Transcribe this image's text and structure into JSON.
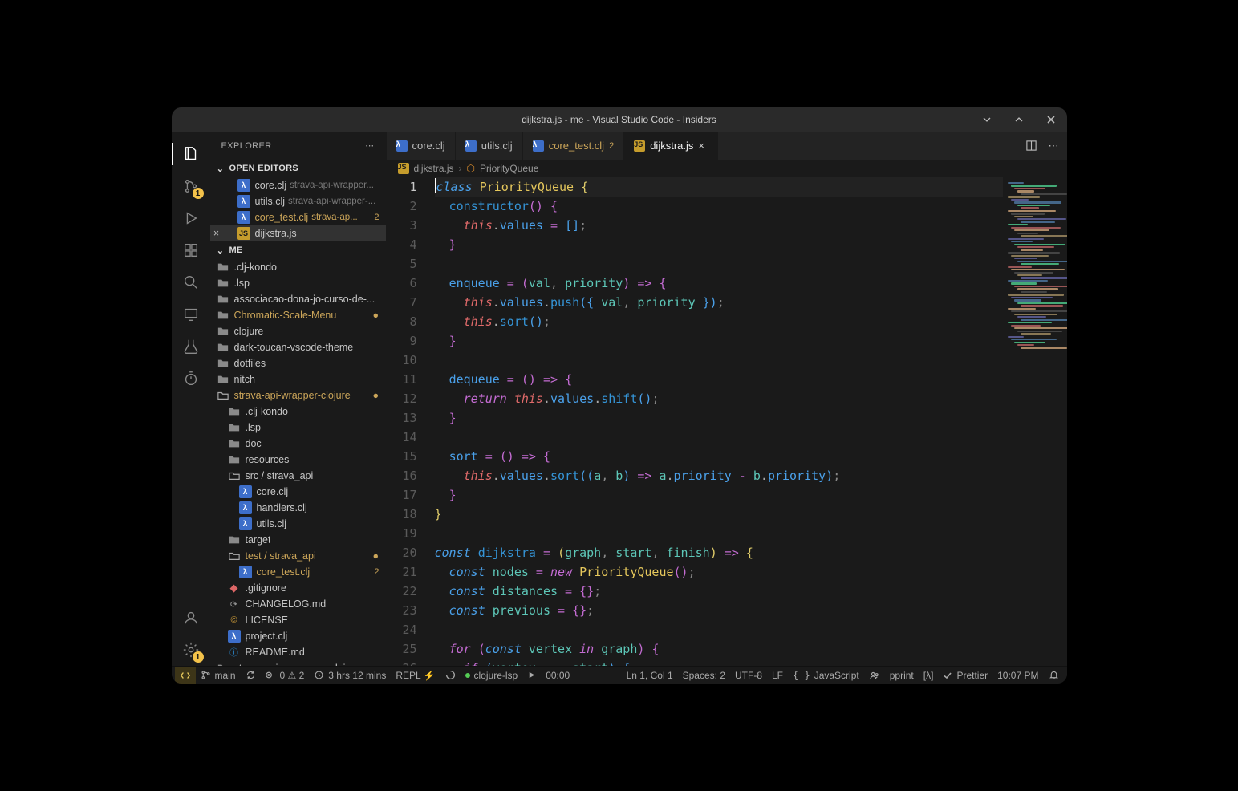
{
  "window": {
    "title": "dijkstra.js - me - Visual Studio Code - Insiders"
  },
  "activitybar": {
    "items": [
      {
        "name": "files-icon",
        "active": true
      },
      {
        "name": "source-control-icon",
        "badge": "1"
      },
      {
        "name": "run-debug-icon"
      },
      {
        "name": "extensions-icon"
      },
      {
        "name": "search-icon"
      },
      {
        "name": "remote-icon"
      },
      {
        "name": "beaker-icon"
      },
      {
        "name": "timer-icon"
      }
    ],
    "bottom": [
      {
        "name": "account-icon"
      },
      {
        "name": "settings-icon",
        "badge": "1"
      }
    ]
  },
  "sidebar": {
    "title": "EXPLORER",
    "sections": {
      "openEditors": {
        "label": "OPEN EDITORS",
        "items": [
          {
            "icon": "lambda",
            "name": "core.clj",
            "meta": "strava-api-wrapper...",
            "indent": 34
          },
          {
            "icon": "lambda",
            "name": "utils.clj",
            "meta": "strava-api-wrapper-...",
            "indent": 34
          },
          {
            "icon": "lambda",
            "name": "core_test.clj",
            "meta": "strava-ap...",
            "indent": 34,
            "modified": true,
            "badge": "2"
          },
          {
            "icon": "js",
            "name": "dijkstra.js",
            "indent": 34,
            "active": true,
            "close": true
          }
        ]
      },
      "workspace": {
        "label": "ME",
        "items": [
          {
            "icon": "folder",
            "name": ".clj-kondo",
            "indent": 8,
            "type": "folder"
          },
          {
            "icon": "folder",
            "name": ".lsp",
            "indent": 8,
            "type": "folder"
          },
          {
            "icon": "folder",
            "name": "associacao-dona-jo-curso-de-...",
            "indent": 8,
            "type": "folder"
          },
          {
            "icon": "folder",
            "name": "Chromatic-Scale-Menu",
            "indent": 8,
            "type": "folder",
            "modified": true,
            "dot": true
          },
          {
            "icon": "folder",
            "name": "clojure",
            "indent": 8,
            "type": "folder"
          },
          {
            "icon": "folder",
            "name": "dark-toucan-vscode-theme",
            "indent": 8,
            "type": "folder"
          },
          {
            "icon": "folder",
            "name": "dotfiles",
            "indent": 8,
            "type": "folder"
          },
          {
            "icon": "folder",
            "name": "nitch",
            "indent": 8,
            "type": "folder"
          },
          {
            "icon": "folder-o",
            "name": "strava-api-wrapper-clojure",
            "indent": 8,
            "type": "folder",
            "modified": true,
            "dot": true
          },
          {
            "icon": "folder",
            "name": ".clj-kondo",
            "indent": 22,
            "type": "folder"
          },
          {
            "icon": "folder",
            "name": ".lsp",
            "indent": 22,
            "type": "folder"
          },
          {
            "icon": "folder",
            "name": "doc",
            "indent": 22,
            "type": "folder"
          },
          {
            "icon": "folder",
            "name": "resources",
            "indent": 22,
            "type": "folder"
          },
          {
            "icon": "folder-o",
            "name": "src / strava_api",
            "indent": 22,
            "type": "folder"
          },
          {
            "icon": "lambda",
            "name": "core.clj",
            "indent": 36,
            "type": "file"
          },
          {
            "icon": "lambda",
            "name": "handlers.clj",
            "indent": 36,
            "type": "file"
          },
          {
            "icon": "lambda",
            "name": "utils.clj",
            "indent": 36,
            "type": "file"
          },
          {
            "icon": "folder",
            "name": "target",
            "indent": 22,
            "type": "folder"
          },
          {
            "icon": "folder-o",
            "name": "test / strava_api",
            "indent": 22,
            "type": "folder",
            "modified": true,
            "dot": true
          },
          {
            "icon": "lambda",
            "name": "core_test.clj",
            "indent": 36,
            "type": "file",
            "modified": true,
            "badge": "2"
          },
          {
            "icon": "git",
            "name": ".gitignore",
            "indent": 22,
            "type": "file"
          },
          {
            "icon": "md",
            "name": "CHANGELOG.md",
            "indent": 22,
            "type": "file"
          },
          {
            "icon": "lic",
            "name": "LICENSE",
            "indent": 22,
            "type": "file"
          },
          {
            "icon": "lambda",
            "name": "project.clj",
            "indent": 22,
            "type": "file"
          },
          {
            "icon": "info",
            "name": "README.md",
            "indent": 22,
            "type": "file"
          },
          {
            "icon": "folder",
            "name": "strava-api-wrapper-nodejs",
            "indent": 8,
            "type": "folder"
          }
        ]
      }
    }
  },
  "tabs": [
    {
      "icon": "lambda",
      "label": "core.clj"
    },
    {
      "icon": "lambda",
      "label": "utils.clj"
    },
    {
      "icon": "lambda",
      "label": "core_test.clj",
      "modified": true,
      "badge": "2"
    },
    {
      "icon": "js",
      "label": "dijkstra.js",
      "active": true,
      "close": true
    }
  ],
  "breadcrumb": {
    "file_icon": "js",
    "file": "dijkstra.js",
    "symbol_icon": "class",
    "symbol": "PriorityQueue"
  },
  "code": {
    "cursor_line": 1,
    "lines": [
      [
        [
          "cursor",
          ""
        ],
        [
          "kw",
          "class "
        ],
        [
          "cls",
          "PriorityQueue "
        ],
        [
          "br",
          "{"
        ]
      ],
      [
        [
          "pad",
          "  "
        ],
        [
          "fn",
          "constructor"
        ],
        [
          "br2",
          "() "
        ],
        [
          "br2",
          "{"
        ]
      ],
      [
        [
          "pad",
          "    "
        ],
        [
          "this",
          "this"
        ],
        [
          "dot",
          "."
        ],
        [
          "prop",
          "values"
        ],
        [
          "op",
          " = "
        ],
        [
          "br3",
          "[]"
        ],
        [
          "semi",
          ";"
        ]
      ],
      [
        [
          "pad",
          "  "
        ],
        [
          "br2",
          "}"
        ]
      ],
      [],
      [
        [
          "pad",
          "  "
        ],
        [
          "prop",
          "enqueue"
        ],
        [
          "op",
          " = "
        ],
        [
          "br2",
          "("
        ],
        [
          "id",
          "val"
        ],
        [
          "semi",
          ", "
        ],
        [
          "id",
          "priority"
        ],
        [
          "br2",
          ") "
        ],
        [
          "op",
          "=> "
        ],
        [
          "br2",
          "{"
        ]
      ],
      [
        [
          "pad",
          "    "
        ],
        [
          "this",
          "this"
        ],
        [
          "dot",
          "."
        ],
        [
          "prop",
          "values"
        ],
        [
          "dot",
          "."
        ],
        [
          "fn",
          "push"
        ],
        [
          "br3",
          "({ "
        ],
        [
          "id",
          "val"
        ],
        [
          "semi",
          ", "
        ],
        [
          "id",
          "priority"
        ],
        [
          "br3",
          " })"
        ],
        [
          "semi",
          ";"
        ]
      ],
      [
        [
          "pad",
          "    "
        ],
        [
          "this",
          "this"
        ],
        [
          "dot",
          "."
        ],
        [
          "fn",
          "sort"
        ],
        [
          "br3",
          "()"
        ],
        [
          "semi",
          ";"
        ]
      ],
      [
        [
          "pad",
          "  "
        ],
        [
          "br2",
          "}"
        ]
      ],
      [],
      [
        [
          "pad",
          "  "
        ],
        [
          "prop",
          "dequeue"
        ],
        [
          "op",
          " = "
        ],
        [
          "br2",
          "() "
        ],
        [
          "op",
          "=> "
        ],
        [
          "br2",
          "{"
        ]
      ],
      [
        [
          "pad",
          "    "
        ],
        [
          "kw2",
          "return "
        ],
        [
          "this",
          "this"
        ],
        [
          "dot",
          "."
        ],
        [
          "prop",
          "values"
        ],
        [
          "dot",
          "."
        ],
        [
          "fn",
          "shift"
        ],
        [
          "br3",
          "()"
        ],
        [
          "semi",
          ";"
        ]
      ],
      [
        [
          "pad",
          "  "
        ],
        [
          "br2",
          "}"
        ]
      ],
      [],
      [
        [
          "pad",
          "  "
        ],
        [
          "prop",
          "sort"
        ],
        [
          "op",
          " = "
        ],
        [
          "br2",
          "() "
        ],
        [
          "op",
          "=> "
        ],
        [
          "br2",
          "{"
        ]
      ],
      [
        [
          "pad",
          "    "
        ],
        [
          "this",
          "this"
        ],
        [
          "dot",
          "."
        ],
        [
          "prop",
          "values"
        ],
        [
          "dot",
          "."
        ],
        [
          "fn",
          "sort"
        ],
        [
          "br3",
          "(("
        ],
        [
          "id",
          "a"
        ],
        [
          "semi",
          ", "
        ],
        [
          "id",
          "b"
        ],
        [
          "br3",
          ") "
        ],
        [
          "op",
          "=> "
        ],
        [
          "id",
          "a"
        ],
        [
          "dot",
          "."
        ],
        [
          "prop",
          "priority"
        ],
        [
          "op",
          " - "
        ],
        [
          "id",
          "b"
        ],
        [
          "dot",
          "."
        ],
        [
          "prop",
          "priority"
        ],
        [
          "br3",
          ")"
        ],
        [
          "semi",
          ";"
        ]
      ],
      [
        [
          "pad",
          "  "
        ],
        [
          "br2",
          "}"
        ]
      ],
      [
        [
          "br",
          "}"
        ]
      ],
      [],
      [
        [
          "kw",
          "const "
        ],
        [
          "fn",
          "dijkstra"
        ],
        [
          "op",
          " = "
        ],
        [
          "br",
          "("
        ],
        [
          "id",
          "graph"
        ],
        [
          "semi",
          ", "
        ],
        [
          "id",
          "start"
        ],
        [
          "semi",
          ", "
        ],
        [
          "id",
          "finish"
        ],
        [
          "br",
          ") "
        ],
        [
          "op",
          "=> "
        ],
        [
          "br",
          "{"
        ]
      ],
      [
        [
          "pad",
          "  "
        ],
        [
          "kw",
          "const "
        ],
        [
          "id",
          "nodes"
        ],
        [
          "op",
          " = "
        ],
        [
          "kw2",
          "new "
        ],
        [
          "cls",
          "PriorityQueue"
        ],
        [
          "br2",
          "()"
        ],
        [
          "semi",
          ";"
        ]
      ],
      [
        [
          "pad",
          "  "
        ],
        [
          "kw",
          "const "
        ],
        [
          "id",
          "distances"
        ],
        [
          "op",
          " = "
        ],
        [
          "br2",
          "{}"
        ],
        [
          "semi",
          ";"
        ]
      ],
      [
        [
          "pad",
          "  "
        ],
        [
          "kw",
          "const "
        ],
        [
          "id",
          "previous"
        ],
        [
          "op",
          " = "
        ],
        [
          "br2",
          "{}"
        ],
        [
          "semi",
          ";"
        ]
      ],
      [],
      [
        [
          "pad",
          "  "
        ],
        [
          "kw2",
          "for "
        ],
        [
          "br2",
          "("
        ],
        [
          "kw",
          "const "
        ],
        [
          "id",
          "vertex"
        ],
        [
          "kw2",
          " in "
        ],
        [
          "id",
          "graph"
        ],
        [
          "br2",
          ") "
        ],
        [
          "br2",
          "{"
        ]
      ],
      [
        [
          "pad",
          "    "
        ],
        [
          "kw2",
          "if "
        ],
        [
          "br3",
          "("
        ],
        [
          "id",
          "vertex"
        ],
        [
          "op",
          " === "
        ],
        [
          "id",
          "start"
        ],
        [
          "br3",
          ") "
        ],
        [
          "br3",
          "{"
        ]
      ]
    ]
  },
  "status": {
    "left": [
      {
        "name": "remote-indicator",
        "icon": "remote",
        "accent": true
      },
      {
        "name": "branch",
        "icon": "branch",
        "text": "main"
      },
      {
        "name": "sync",
        "icon": "sync"
      },
      {
        "name": "problems",
        "icon": "error-warn",
        "text": "0  ⚠ 2"
      },
      {
        "name": "wakatime",
        "icon": "clock",
        "text": "3 hrs 12 mins"
      },
      {
        "name": "repl",
        "text": "REPL ⚡"
      },
      {
        "name": "calva-loading",
        "icon": "loading"
      },
      {
        "name": "lsp",
        "icon": "dot",
        "text": "clojure-lsp"
      },
      {
        "name": "play",
        "icon": "play"
      },
      {
        "name": "timer",
        "text": "00:00"
      }
    ],
    "right": [
      {
        "name": "cursor-pos",
        "text": "Ln 1, Col 1"
      },
      {
        "name": "indent",
        "text": "Spaces: 2"
      },
      {
        "name": "encoding",
        "text": "UTF-8"
      },
      {
        "name": "eol",
        "text": "LF"
      },
      {
        "name": "lang",
        "icon": "braces",
        "text": "JavaScript"
      },
      {
        "name": "live-share",
        "icon": "people"
      },
      {
        "name": "pprint",
        "text": "pprint"
      },
      {
        "name": "lambda",
        "text": "[λ]"
      },
      {
        "name": "prettier",
        "icon": "check",
        "text": "Prettier"
      },
      {
        "name": "clock",
        "text": "10:07 PM"
      },
      {
        "name": "bell",
        "icon": "bell"
      }
    ]
  }
}
